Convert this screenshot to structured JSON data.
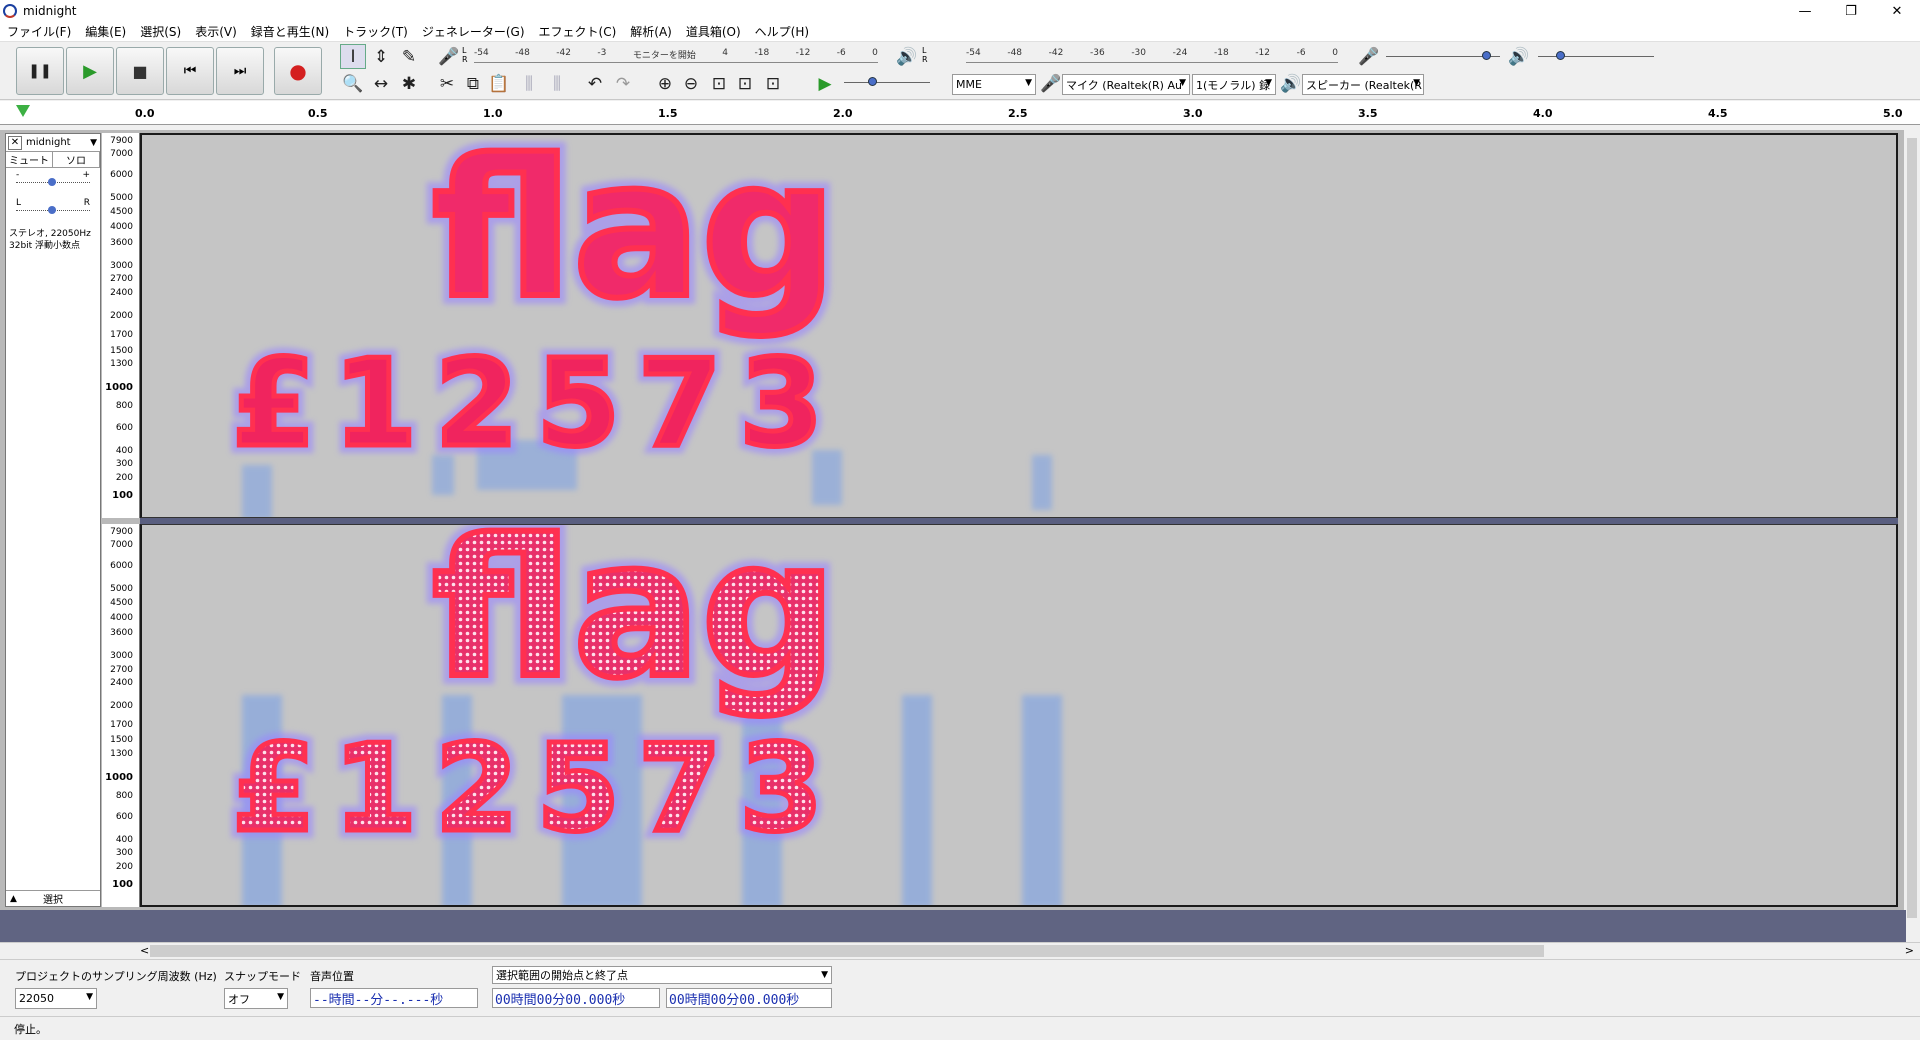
{
  "window": {
    "title": "midnight",
    "minimize": "—",
    "restore": "❐",
    "close": "✕"
  },
  "menu": [
    "ファイル(F)",
    "編集(E)",
    "選択(S)",
    "表示(V)",
    "録音と再生(N)",
    "トラック(T)",
    "ジェネレーター(G)",
    "エフェクト(C)",
    "解析(A)",
    "道具箱(O)",
    "ヘルプ(H)"
  ],
  "transport": {
    "pause": "❚❚",
    "play": "▶",
    "stop": "■",
    "skip_start": "⏮",
    "skip_end": "⏭",
    "record": "●"
  },
  "tools_row1": [
    "I",
    "⇕",
    "✎",
    "🎤"
  ],
  "tools_row2": [
    "🔍",
    "↔",
    "✱"
  ],
  "edit_tools": [
    "✂",
    "⧉",
    "📋",
    "⫼",
    "⫼",
    "↶",
    "↷",
    "⊕",
    "⊖",
    "⊡",
    "⊡",
    "⊡"
  ],
  "rec_meter": {
    "lr": "L\nR",
    "ticks": [
      "-54",
      "-48",
      "-42",
      "-3",
      "モニターを開始",
      "4",
      "-18",
      "-12",
      "-6",
      "0"
    ]
  },
  "play_meter": {
    "lr": "L\nR",
    "ticks": [
      "-54",
      "-48",
      "-42",
      "-36",
      "-30",
      "-24",
      "-18",
      "-12",
      "-6",
      "0"
    ]
  },
  "devices": {
    "host": "MME",
    "mic": "マイク (Realtek(R) Au",
    "channels": "1(モノラル) 録",
    "speaker": "スピーカー (Realtek(R"
  },
  "ruler": {
    "ticks": [
      "0.0",
      "0.5",
      "1.0",
      "1.5",
      "2.0",
      "2.5",
      "3.0",
      "3.5",
      "4.0",
      "4.5",
      "5.0"
    ]
  },
  "track": {
    "name": "midnight",
    "mute": "ミュート",
    "solo": "ソロ",
    "gain_minus": "-",
    "gain_plus": "+",
    "pan_l": "L",
    "pan_r": "R",
    "info_line1": "ステレオ, 22050Hz",
    "info_line2": "32bit 浮動小数点",
    "select": "選択",
    "collapse": "▲"
  },
  "freq_scale": [
    "7900",
    "7000",
    "6000",
    "5000",
    "4500",
    "4000",
    "3600",
    "3000",
    "2700",
    "2400",
    "2000",
    "1700",
    "1500",
    "1300",
    "1000",
    "800",
    "600",
    "400",
    "300",
    "200",
    "100"
  ],
  "spectrogram_text": {
    "top": "flag",
    "bottom": "£12573"
  },
  "selection_toolbar": {
    "rate_label": "プロジェクトのサンプリング周波数 (Hz)",
    "rate_value": "22050",
    "snap_label": "スナップモード",
    "snap_value": "オフ",
    "pos_label": "音声位置",
    "pos_value": "--時間--分--.---秒",
    "range_label": "選択範囲の開始点と終了点",
    "start_value": "00時間00分00.000秒",
    "end_value": "00時間00分00.000秒"
  },
  "status": "停止。"
}
